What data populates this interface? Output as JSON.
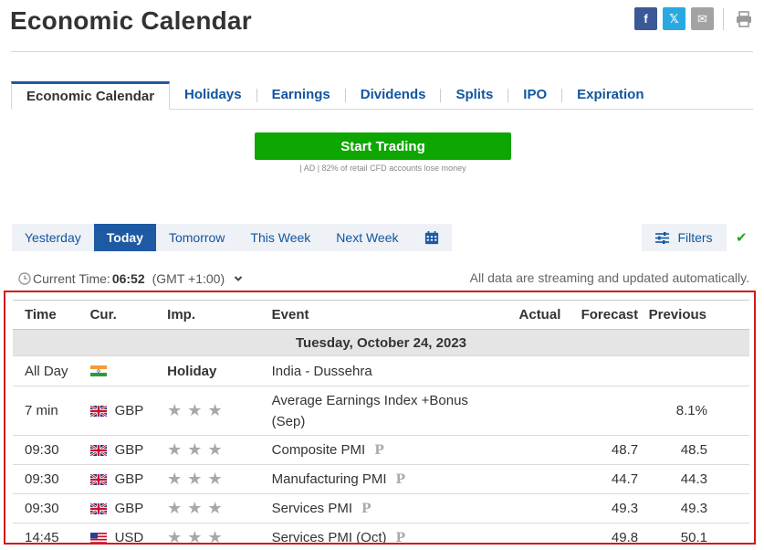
{
  "header": {
    "title": "Economic Calendar",
    "share": {
      "facebook": {
        "glyph": "f",
        "color": "#3b5998"
      },
      "x": {
        "glyph": "𝕏",
        "color": "#29a9e1"
      },
      "email": {
        "glyph": "✉",
        "color": "#a3a3a3"
      },
      "print_icon": "printer-icon"
    }
  },
  "tabs": [
    {
      "label": "Economic Calendar",
      "active": true
    },
    {
      "label": "Holidays"
    },
    {
      "label": "Earnings"
    },
    {
      "label": "Dividends"
    },
    {
      "label": "Splits"
    },
    {
      "label": "IPO"
    },
    {
      "label": "Expiration"
    }
  ],
  "promo": {
    "button_label": "Start Trading",
    "note": "| AD | 82% of retail CFD accounts lose money",
    "color": "#0ea600"
  },
  "periods": [
    {
      "label": "Yesterday"
    },
    {
      "label": "Today",
      "active": true
    },
    {
      "label": "Tomorrow"
    },
    {
      "label": "This Week"
    },
    {
      "label": "Next Week"
    }
  ],
  "calendar_icon": "calendar-icon",
  "filters": {
    "label": "Filters",
    "icon": "sliders-icon",
    "check_icon": "checkmark-icon"
  },
  "time_info": {
    "label": "Current Time:",
    "value": "06:52",
    "zone": "(GMT +1:00)",
    "streaming_note": "All data are streaming and updated automatically."
  },
  "table": {
    "headers": {
      "time": "Time",
      "cur": "Cur.",
      "imp": "Imp.",
      "event": "Event",
      "actual": "Actual",
      "forecast": "Forecast",
      "previous": "Previous"
    },
    "date": "Tuesday, October 24, 2023",
    "rows": [
      {
        "time": "All Day",
        "flag": "IN",
        "currency": "",
        "importance": "Holiday",
        "event": "India - Dussehra",
        "actual": "",
        "forecast": "",
        "previous": ""
      },
      {
        "time": "7 min",
        "flag": "GB",
        "currency": "GBP",
        "importance": 3,
        "event_line1": "Average Earnings Index +Bonus",
        "event_line2": "(Sep)",
        "actual": "",
        "forecast": "",
        "previous": "8.1%"
      },
      {
        "time": "09:30",
        "flag": "GB",
        "currency": "GBP",
        "importance": 3,
        "event": "Composite PMI",
        "preliminary": "P",
        "actual": "",
        "forecast": "48.7",
        "previous": "48.5"
      },
      {
        "time": "09:30",
        "flag": "GB",
        "currency": "GBP",
        "importance": 3,
        "event": "Manufacturing PMI",
        "preliminary": "P",
        "actual": "",
        "forecast": "44.7",
        "previous": "44.3"
      },
      {
        "time": "09:30",
        "flag": "GB",
        "currency": "GBP",
        "importance": 3,
        "event": "Services PMI",
        "preliminary": "P",
        "actual": "",
        "forecast": "49.3",
        "previous": "49.3"
      },
      {
        "time": "14:45",
        "flag": "US",
        "currency": "USD",
        "importance": 3,
        "event": "Services PMI (Oct)",
        "preliminary": "P",
        "actual": "",
        "forecast": "49.8",
        "previous": "50.1"
      }
    ]
  },
  "colors": {
    "link": "#1256a0",
    "active_blue": "#1d5aa3",
    "highlight_border": "#d11a1a",
    "star_gray": "#a8a8a8"
  }
}
